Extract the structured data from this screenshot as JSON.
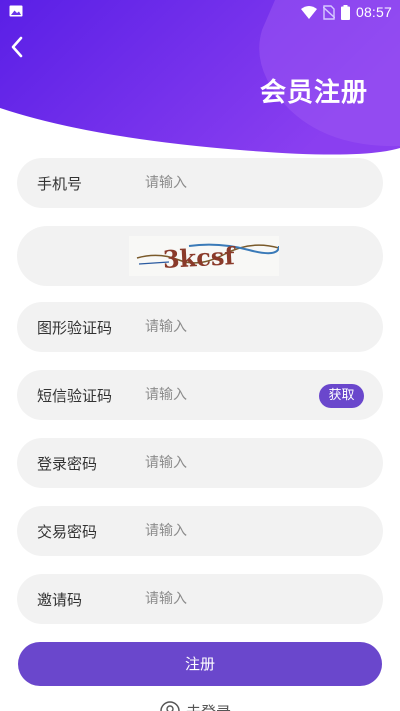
{
  "status_bar": {
    "time": "08:57",
    "icons": [
      "image-icon",
      "wifi-icon",
      "no-sim-icon",
      "battery-icon"
    ]
  },
  "header": {
    "title": "会员注册",
    "back_icon": "chevron-left-icon",
    "gradient": [
      "#5b21e8",
      "#8a3ef2"
    ]
  },
  "form": {
    "phone": {
      "label": "手机号",
      "placeholder": "请输入"
    },
    "captcha": {
      "image_text": "3kcsf"
    },
    "image_code": {
      "label": "图形验证码",
      "placeholder": "请输入"
    },
    "sms_code": {
      "label": "短信验证码",
      "placeholder": "请输入",
      "get_button": "获取"
    },
    "login_password": {
      "label": "登录密码",
      "placeholder": "请输入"
    },
    "trade_password": {
      "label": "交易密码",
      "placeholder": "请输入"
    },
    "invite_code": {
      "label": "邀请码",
      "placeholder": "请输入"
    }
  },
  "submit_label": "注册",
  "login_link": {
    "label": "去登录",
    "icon": "user-icon"
  },
  "colors": {
    "accent": "#6a47cc",
    "row_bg": "#f2f2f2"
  }
}
